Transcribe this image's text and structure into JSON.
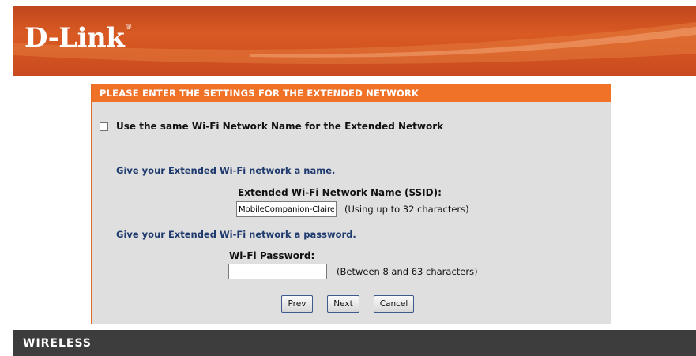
{
  "header": {
    "logo_text": "D-Link",
    "logo_mark": "®"
  },
  "panel": {
    "title": "PLEASE ENTER THE SETTINGS FOR THE EXTENDED NETWORK",
    "same_name_checkbox_label": "Use the same Wi-Fi Network Name for the Extended Network",
    "same_name_checked": false,
    "name_section_text": "Give your Extended Wi-Fi network a name.",
    "ssid_label": "Extended Wi-Fi Network Name (SSID):",
    "ssid_value": "MobileCompanion-Claire-",
    "ssid_hint": "(Using up to 32 characters)",
    "password_section_text": "Give your Extended Wi-Fi network a password.",
    "password_label": "Wi-Fi Password:",
    "password_value": "",
    "password_hint": "(Between 8 and 63 characters)"
  },
  "buttons": {
    "prev": "Prev",
    "next": "Next",
    "cancel": "Cancel"
  },
  "footer": {
    "label": "WIRELESS"
  },
  "colors": {
    "header_orange": "#d95a22",
    "panel_title_orange": "#f07227",
    "section_blue": "#1f3a6e",
    "footer_gray": "#3d3d3d"
  }
}
